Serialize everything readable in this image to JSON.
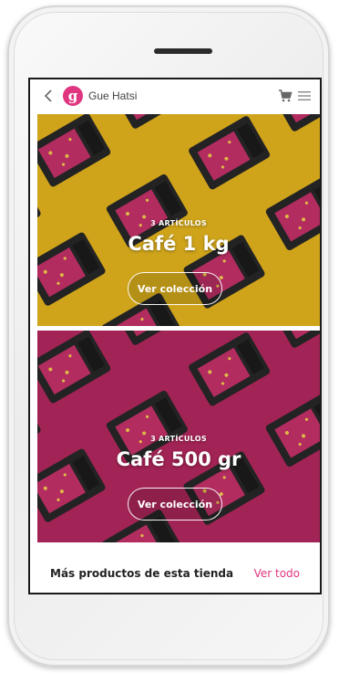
{
  "header": {
    "logo_letter": "g",
    "store_name": "Gue Hatsi"
  },
  "banners": [
    {
      "count": "3 ARTÍCULOS",
      "title": "Café 1 kg",
      "cta": "Ver colección",
      "color": "#e1b21e"
    },
    {
      "count": "3 ARTÍCULOS",
      "title": "Café 500 gr",
      "cta": "Ver colección",
      "color": "#b0275d"
    }
  ],
  "more": {
    "title": "Más productos de esta tienda",
    "link": "Ver todo"
  },
  "colors": {
    "accent": "#e0367f",
    "bag": "#262626",
    "label": "#c23069"
  }
}
